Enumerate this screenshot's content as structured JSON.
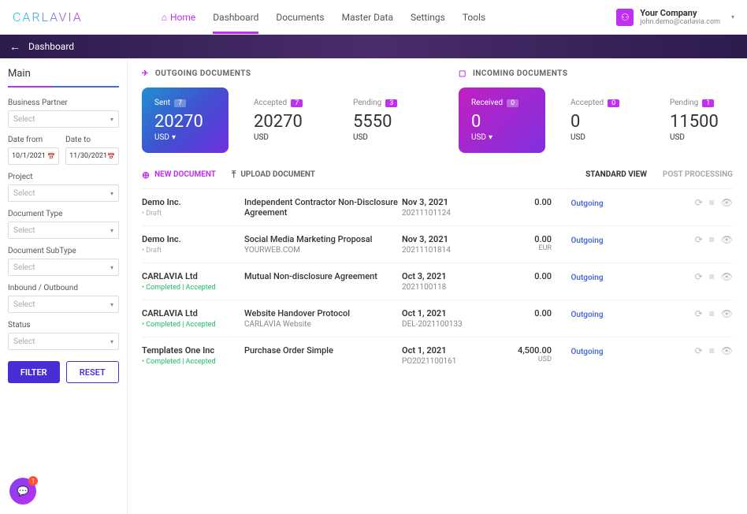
{
  "brand": "CARLAVIA",
  "nav": {
    "items": [
      "Home",
      "Dashboard",
      "Documents",
      "Master Data",
      "Settings",
      "Tools"
    ],
    "active": 1
  },
  "account": {
    "name": "Your Company",
    "email": "john.demo@carlavia.com"
  },
  "header": {
    "title": "Dashboard"
  },
  "sidebar": {
    "title": "Main",
    "labels": {
      "business_partner": "Business Partner",
      "date_from": "Date from",
      "date_to": "Date to",
      "project": "Project",
      "document_type": "Document Type",
      "document_subtype": "Document SubType",
      "inbound_outbound": "Inbound / Outbound",
      "status": "Status"
    },
    "values": {
      "select_placeholder": "Select",
      "date_from": "10/1/2021",
      "date_to": "11/30/2021"
    },
    "buttons": {
      "filter": "FILTER",
      "reset": "RESET"
    },
    "chat_badge": "1"
  },
  "stats": {
    "outgoing": {
      "title": "OUTGOING DOCUMENTS",
      "cards": [
        {
          "label": "Sent",
          "badge": "7",
          "value": "20270",
          "currency": "USD"
        },
        {
          "label": "Accepted",
          "badge": "7",
          "value": "20270",
          "currency": "USD"
        },
        {
          "label": "Pending",
          "badge": "3",
          "value": "5550",
          "currency": "USD"
        }
      ]
    },
    "incoming": {
      "title": "INCOMING DOCUMENTS",
      "cards": [
        {
          "label": "Received",
          "badge": "0",
          "value": "0",
          "currency": "USD"
        },
        {
          "label": "Accepted",
          "badge": "0",
          "value": "0",
          "currency": "USD"
        },
        {
          "label": "Pending",
          "badge": "1",
          "value": "11500",
          "currency": "USD"
        }
      ]
    }
  },
  "actions": {
    "new_document": "NEW DOCUMENT",
    "upload_document": "UPLOAD DOCUMENT",
    "view_standard": "STANDARD VIEW",
    "view_post": "POST PROCESSING"
  },
  "documents": [
    {
      "company": "Demo Inc.",
      "status": "• Draft",
      "status_class": "draft",
      "title": "Independent Contractor Non-Disclosure Agreement",
      "subtitle": "",
      "date": "Nov 3, 2021",
      "ref": "20211101124",
      "amount": "0.00",
      "currency": "",
      "direction": "Outgoing"
    },
    {
      "company": "Demo Inc.",
      "status": "• Draft",
      "status_class": "draft",
      "title": "Social Media Marketing Proposal",
      "subtitle": "YOURWEB.COM",
      "date": "Nov 3, 2021",
      "ref": "20211101814",
      "amount": "0.00",
      "currency": "EUR",
      "direction": "Outgoing"
    },
    {
      "company": "CARLAVIA Ltd",
      "status": "• Completed | Accepted",
      "status_class": "completed",
      "title": "Mutual Non-disclosure Agreement",
      "subtitle": "",
      "date": "Oct 3, 2021",
      "ref": "2021100118",
      "amount": "0.00",
      "currency": "",
      "direction": "Outgoing"
    },
    {
      "company": "CARLAVIA Ltd",
      "status": "• Completed | Accepted",
      "status_class": "completed",
      "title": "Website Handover Protocol",
      "subtitle": "CARLAVIA Website",
      "date": "Oct 1, 2021",
      "ref": "DEL-2021100133",
      "amount": "0.00",
      "currency": "",
      "direction": "Outgoing"
    },
    {
      "company": "Templates One Inc",
      "status": "• Completed | Accepted",
      "status_class": "completed",
      "title": "Purchase Order Simple",
      "subtitle": "",
      "date": "Oct 1, 2021",
      "ref": "PO2021100161",
      "amount": "4,500.00",
      "currency": "USD",
      "direction": "Outgoing"
    }
  ]
}
